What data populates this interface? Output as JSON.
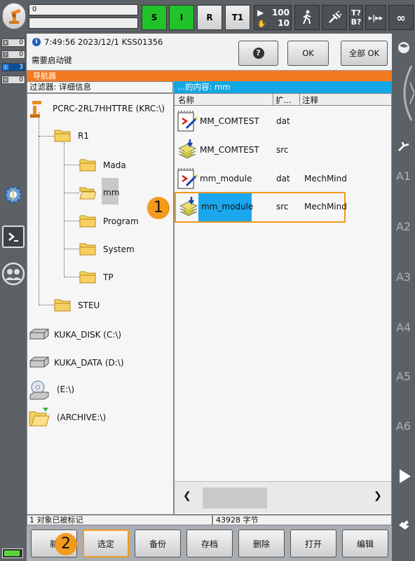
{
  "topbar": {
    "program_line1": "0",
    "program_line2": "",
    "status_s": "S",
    "status_i": "I",
    "status_r": "R",
    "mode": "T1",
    "override_run": "100",
    "override_jog": "10",
    "tool_top": "T?",
    "tool_bottom": "B?",
    "increment": "∞"
  },
  "message_counts": [
    {
      "icon": "x",
      "value": "0"
    },
    {
      "icon": "!",
      "value": "0"
    },
    {
      "icon": "i",
      "value": "3"
    },
    {
      "icon": "<",
      "value": "0"
    }
  ],
  "message": {
    "time_text": "7:49:56 2023/12/1 KSS01356",
    "text": "需要启动键",
    "help_label": "?",
    "ok_label": "OK",
    "all_ok_label": "全部 OK"
  },
  "navigator": {
    "title": "导航器",
    "filter_label": "过滤器: 详细信息",
    "content_label": "...的内容: mm"
  },
  "tree": {
    "root": "PCRC-2RL7HHTTRE (KRC:\\)",
    "r1": "R1",
    "children": [
      "Mada",
      "mm",
      "Program",
      "System",
      "TP"
    ],
    "steu": "STEU",
    "drives": [
      "KUKA_DISK (C:\\)",
      "KUKA_DATA (D:\\)",
      "(E:\\)",
      "(ARCHIVE:\\)"
    ]
  },
  "filelist": {
    "columns": [
      "名称",
      "扩...",
      "注释"
    ],
    "rows": [
      {
        "name": "MM_COMTEST",
        "ext": "dat",
        "comment": ""
      },
      {
        "name": "MM_COMTEST",
        "ext": "src",
        "comment": ""
      },
      {
        "name": "mm_module",
        "ext": "dat",
        "comment": "MechMind"
      },
      {
        "name": "mm_module",
        "ext": "src",
        "comment": "MechMind"
      }
    ]
  },
  "status": {
    "marked": "1 对象已被标记",
    "bytes": "43928 字节"
  },
  "buttons": [
    "新",
    "选定",
    "备份",
    "存档",
    "删除",
    "打开",
    "编辑"
  ],
  "right_axes": [
    "A1",
    "A2",
    "A3",
    "A4",
    "A5",
    "A6"
  ],
  "callouts": [
    "1",
    "2"
  ],
  "colors": {
    "navigator_title": "#f47a20",
    "content_bar": "#13a7e3",
    "selection": "#1aa7ee",
    "highlight_border": "#f39a1d",
    "status_green": "#22c32a"
  }
}
